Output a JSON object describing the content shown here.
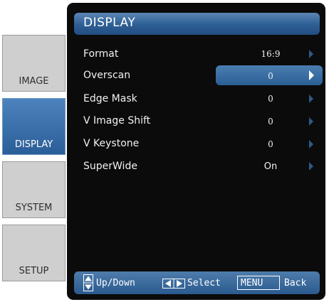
{
  "sidebar": {
    "tabs": [
      {
        "label": "IMAGE",
        "active": false
      },
      {
        "label": "DISPLAY",
        "active": true
      },
      {
        "label": "SYSTEM",
        "active": false
      },
      {
        "label": "SETUP",
        "active": false
      }
    ]
  },
  "header": {
    "title": "DISPLAY"
  },
  "menu": {
    "rows": [
      {
        "label": "Format",
        "value": "16:9",
        "selected": false
      },
      {
        "label": "Overscan",
        "value": "0",
        "selected": true
      },
      {
        "label": "Edge Mask",
        "value": "0",
        "selected": false
      },
      {
        "label": "V Image Shift",
        "value": "0",
        "selected": false
      },
      {
        "label": "V Keystone",
        "value": "0",
        "selected": false
      },
      {
        "label": "SuperWide",
        "value": "On",
        "selected": false
      }
    ]
  },
  "footer": {
    "updown_label": "Up/Down",
    "select_label": "Select",
    "menu_key": "MENU",
    "back_label": "Back"
  },
  "colors": {
    "accent": "#2d5e94",
    "panel": "#0b0b0b",
    "tab_inactive": "#cfcfcf"
  },
  "icons": {
    "updown": "up-down-arrows-icon",
    "leftright": "left-right-arrows-icon",
    "row_arrow": "chevron-right-icon"
  }
}
